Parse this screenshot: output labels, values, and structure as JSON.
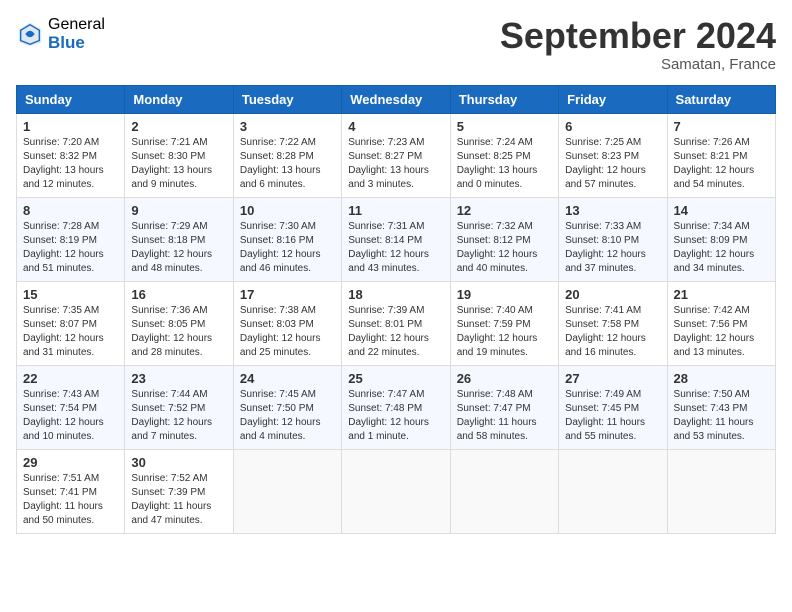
{
  "logo": {
    "general": "General",
    "blue": "Blue"
  },
  "title": "September 2024",
  "location": "Samatan, France",
  "weekdays": [
    "Sunday",
    "Monday",
    "Tuesday",
    "Wednesday",
    "Thursday",
    "Friday",
    "Saturday"
  ],
  "weeks": [
    [
      {
        "day": "1",
        "info": "Sunrise: 7:20 AM\nSunset: 8:32 PM\nDaylight: 13 hours\nand 12 minutes."
      },
      {
        "day": "2",
        "info": "Sunrise: 7:21 AM\nSunset: 8:30 PM\nDaylight: 13 hours\nand 9 minutes."
      },
      {
        "day": "3",
        "info": "Sunrise: 7:22 AM\nSunset: 8:28 PM\nDaylight: 13 hours\nand 6 minutes."
      },
      {
        "day": "4",
        "info": "Sunrise: 7:23 AM\nSunset: 8:27 PM\nDaylight: 13 hours\nand 3 minutes."
      },
      {
        "day": "5",
        "info": "Sunrise: 7:24 AM\nSunset: 8:25 PM\nDaylight: 13 hours\nand 0 minutes."
      },
      {
        "day": "6",
        "info": "Sunrise: 7:25 AM\nSunset: 8:23 PM\nDaylight: 12 hours\nand 57 minutes."
      },
      {
        "day": "7",
        "info": "Sunrise: 7:26 AM\nSunset: 8:21 PM\nDaylight: 12 hours\nand 54 minutes."
      }
    ],
    [
      {
        "day": "8",
        "info": "Sunrise: 7:28 AM\nSunset: 8:19 PM\nDaylight: 12 hours\nand 51 minutes."
      },
      {
        "day": "9",
        "info": "Sunrise: 7:29 AM\nSunset: 8:18 PM\nDaylight: 12 hours\nand 48 minutes."
      },
      {
        "day": "10",
        "info": "Sunrise: 7:30 AM\nSunset: 8:16 PM\nDaylight: 12 hours\nand 46 minutes."
      },
      {
        "day": "11",
        "info": "Sunrise: 7:31 AM\nSunset: 8:14 PM\nDaylight: 12 hours\nand 43 minutes."
      },
      {
        "day": "12",
        "info": "Sunrise: 7:32 AM\nSunset: 8:12 PM\nDaylight: 12 hours\nand 40 minutes."
      },
      {
        "day": "13",
        "info": "Sunrise: 7:33 AM\nSunset: 8:10 PM\nDaylight: 12 hours\nand 37 minutes."
      },
      {
        "day": "14",
        "info": "Sunrise: 7:34 AM\nSunset: 8:09 PM\nDaylight: 12 hours\nand 34 minutes."
      }
    ],
    [
      {
        "day": "15",
        "info": "Sunrise: 7:35 AM\nSunset: 8:07 PM\nDaylight: 12 hours\nand 31 minutes."
      },
      {
        "day": "16",
        "info": "Sunrise: 7:36 AM\nSunset: 8:05 PM\nDaylight: 12 hours\nand 28 minutes."
      },
      {
        "day": "17",
        "info": "Sunrise: 7:38 AM\nSunset: 8:03 PM\nDaylight: 12 hours\nand 25 minutes."
      },
      {
        "day": "18",
        "info": "Sunrise: 7:39 AM\nSunset: 8:01 PM\nDaylight: 12 hours\nand 22 minutes."
      },
      {
        "day": "19",
        "info": "Sunrise: 7:40 AM\nSunset: 7:59 PM\nDaylight: 12 hours\nand 19 minutes."
      },
      {
        "day": "20",
        "info": "Sunrise: 7:41 AM\nSunset: 7:58 PM\nDaylight: 12 hours\nand 16 minutes."
      },
      {
        "day": "21",
        "info": "Sunrise: 7:42 AM\nSunset: 7:56 PM\nDaylight: 12 hours\nand 13 minutes."
      }
    ],
    [
      {
        "day": "22",
        "info": "Sunrise: 7:43 AM\nSunset: 7:54 PM\nDaylight: 12 hours\nand 10 minutes."
      },
      {
        "day": "23",
        "info": "Sunrise: 7:44 AM\nSunset: 7:52 PM\nDaylight: 12 hours\nand 7 minutes."
      },
      {
        "day": "24",
        "info": "Sunrise: 7:45 AM\nSunset: 7:50 PM\nDaylight: 12 hours\nand 4 minutes."
      },
      {
        "day": "25",
        "info": "Sunrise: 7:47 AM\nSunset: 7:48 PM\nDaylight: 12 hours\nand 1 minute."
      },
      {
        "day": "26",
        "info": "Sunrise: 7:48 AM\nSunset: 7:47 PM\nDaylight: 11 hours\nand 58 minutes."
      },
      {
        "day": "27",
        "info": "Sunrise: 7:49 AM\nSunset: 7:45 PM\nDaylight: 11 hours\nand 55 minutes."
      },
      {
        "day": "28",
        "info": "Sunrise: 7:50 AM\nSunset: 7:43 PM\nDaylight: 11 hours\nand 53 minutes."
      }
    ],
    [
      {
        "day": "29",
        "info": "Sunrise: 7:51 AM\nSunset: 7:41 PM\nDaylight: 11 hours\nand 50 minutes."
      },
      {
        "day": "30",
        "info": "Sunrise: 7:52 AM\nSunset: 7:39 PM\nDaylight: 11 hours\nand 47 minutes."
      },
      {
        "day": "",
        "info": ""
      },
      {
        "day": "",
        "info": ""
      },
      {
        "day": "",
        "info": ""
      },
      {
        "day": "",
        "info": ""
      },
      {
        "day": "",
        "info": ""
      }
    ]
  ]
}
